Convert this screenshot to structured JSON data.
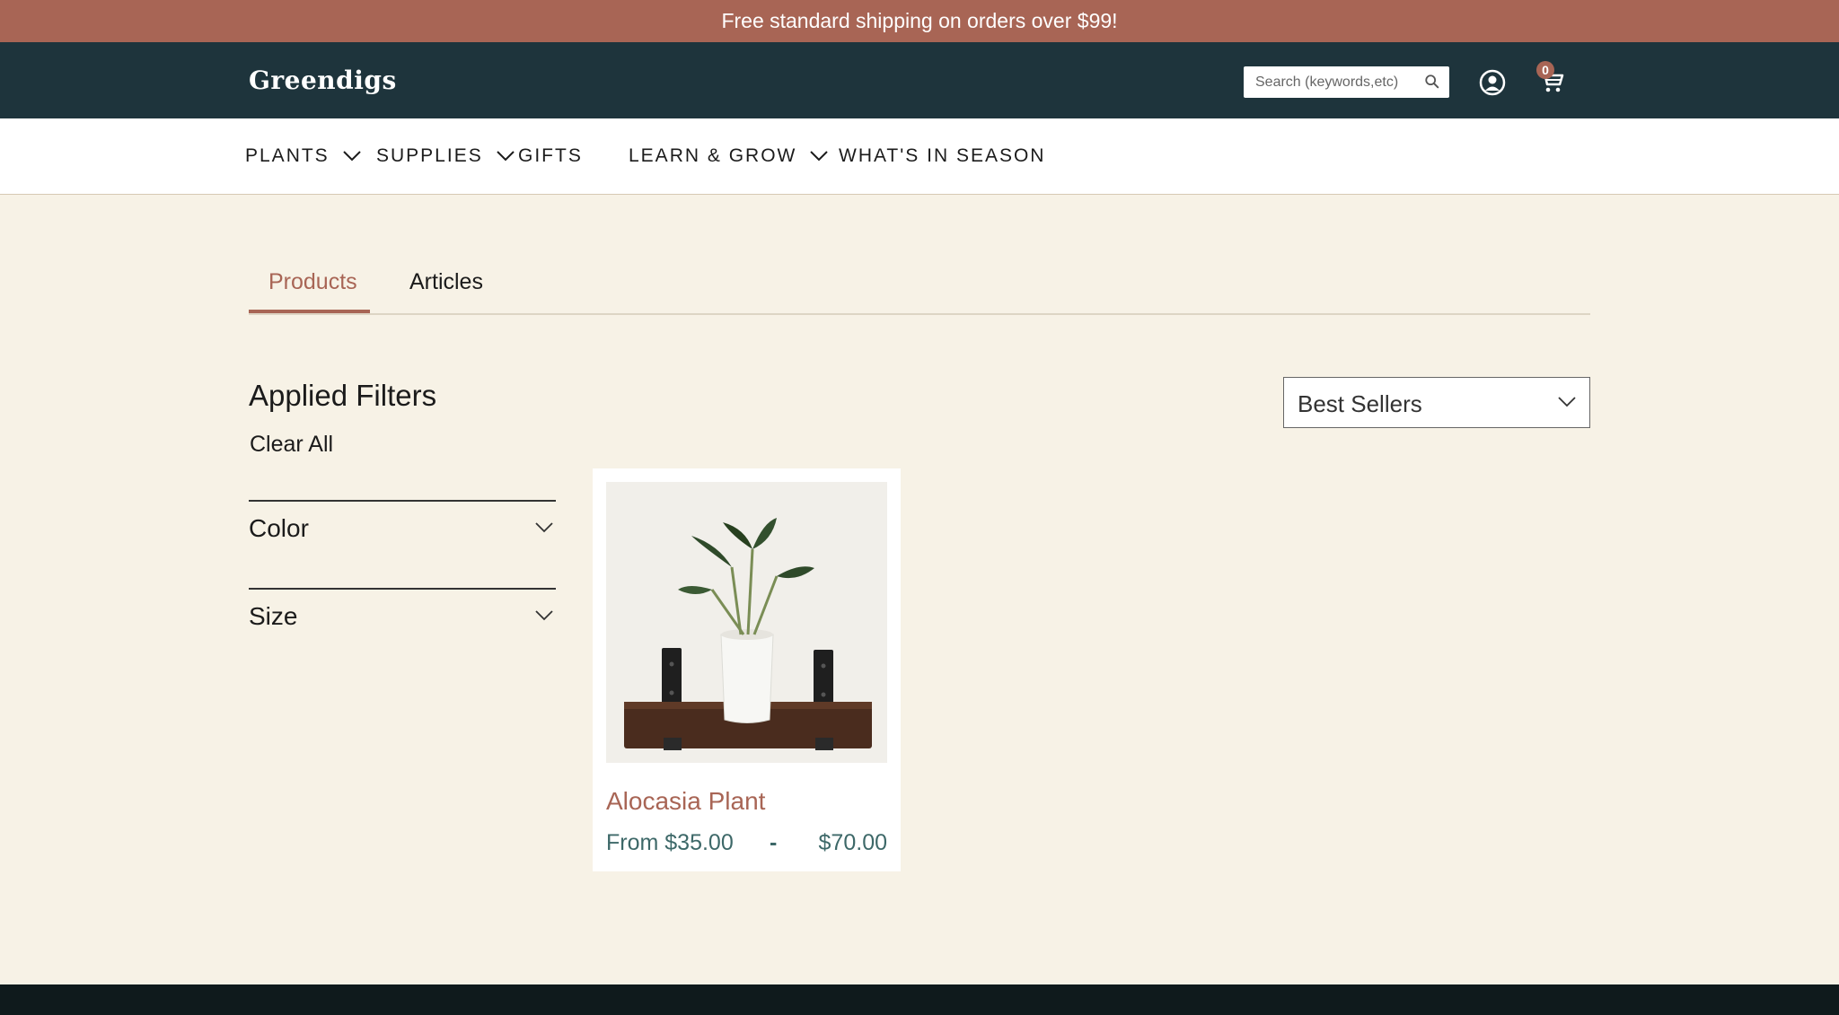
{
  "promo": {
    "text": "Free standard shipping on orders over $99!"
  },
  "header": {
    "logo": "Greendigs",
    "search": {
      "placeholder": "Search (keywords,etc)",
      "value": ""
    },
    "cart_count": "0"
  },
  "nav": {
    "items": [
      {
        "label": "PLANTS",
        "has_dropdown": true
      },
      {
        "label": "SUPPLIES",
        "has_dropdown": true
      },
      {
        "label": "GIFTS",
        "has_dropdown": false
      },
      {
        "label": "LEARN & GROW",
        "has_dropdown": true
      },
      {
        "label": "WHAT'S IN SEASON",
        "has_dropdown": false
      }
    ]
  },
  "tabs": [
    {
      "label": "Products",
      "active": true
    },
    {
      "label": "Articles",
      "active": false
    }
  ],
  "filters": {
    "title": "Applied Filters",
    "clear_all": "Clear All",
    "groups": [
      {
        "label": "Color"
      },
      {
        "label": "Size"
      }
    ]
  },
  "sort": {
    "selected": "Best Sellers"
  },
  "products": [
    {
      "name": "Alocasia Plant",
      "price_from": "From $35.00",
      "price_separator": "-",
      "price_to": "$70.00"
    }
  ],
  "colors": {
    "promo_bg": "#a86555",
    "header_bg": "#1e343c",
    "page_bg": "#f7f2e6",
    "accent": "#a86555",
    "price": "#3d6868"
  }
}
